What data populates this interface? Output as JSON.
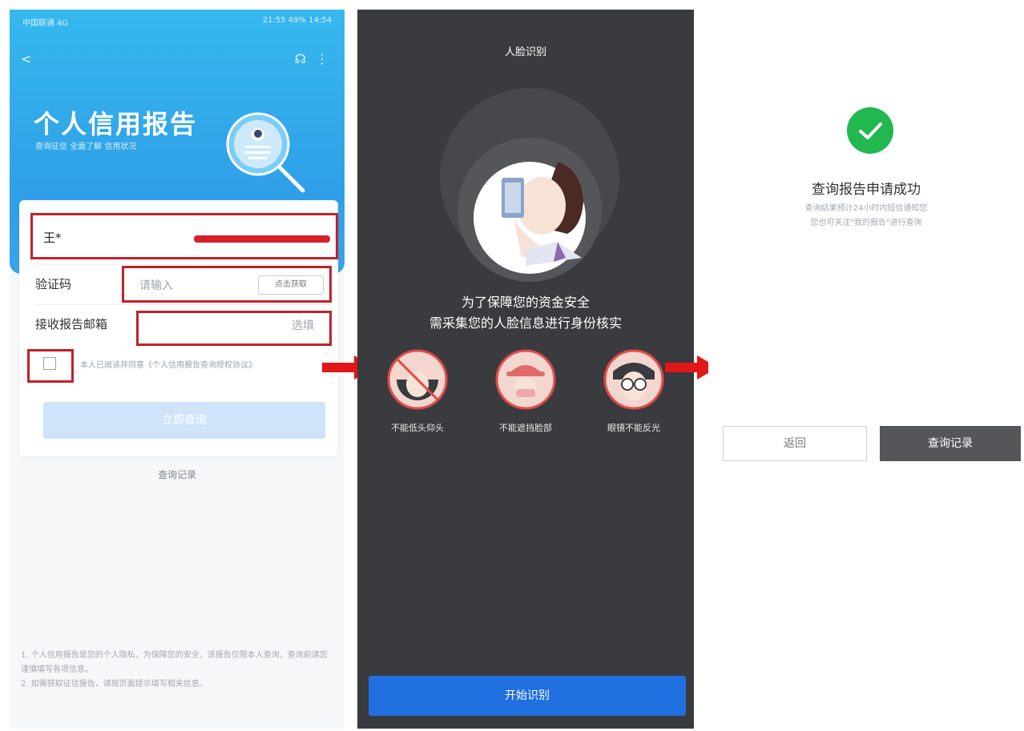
{
  "panel1": {
    "status_left": "中国联通 4G",
    "status_right": "21:55 49% 14:54",
    "back_glyph": "<",
    "help_glyph": "☊",
    "more_glyph": "⋮",
    "title": "个人信用报告",
    "subtitle": "查询征信 全面了解 信用状况",
    "form": {
      "name_value": "王*",
      "captcha_label": "验证码",
      "captcha_placeholder": "请输入",
      "captcha_button": "点击获取",
      "email_label": "接收报告邮箱",
      "email_placeholder": "选填",
      "agree_text": "本人已阅读并同意《个人信用报告查询授权协议》",
      "submit_label": "立即查询"
    },
    "query_link": "查询记录",
    "notes": [
      "1. 个人信用报告是您的个人隐私，为保障您的安全，该报告仅限本人查询，查询前请您谨慎填写各项信息。",
      "2. 如需获取征信报告，请按页面提示填写相关信息。"
    ]
  },
  "panel2": {
    "title": "人脸识别",
    "line1": "为了保障您的资金安全",
    "line2": "需采集您的人脸信息进行身份核实",
    "tips": [
      {
        "label": "不能低头仰头"
      },
      {
        "label": "不能遮挡脸部"
      },
      {
        "label": "眼镜不能反光"
      }
    ],
    "start_button": "开始识别"
  },
  "panel3": {
    "title": "查询报告申请成功",
    "desc_line1": "查询结果预计24小时内短信通知您",
    "desc_line2": "您也可关注\"我的报告\"进行查询",
    "back_button": "返回",
    "records_button": "查询记录"
  },
  "colors": {
    "header_blue": "#2f9fe8",
    "highlight_red": "#c2212a",
    "arrow_red": "#e01818",
    "dark_bg": "#3a3b3e",
    "start_blue": "#1f6fe0",
    "success_green": "#22b84f"
  }
}
